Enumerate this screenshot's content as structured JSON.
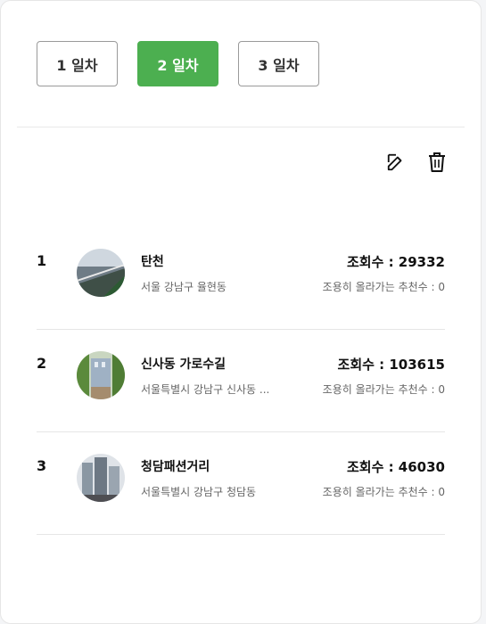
{
  "tabs": [
    {
      "label": "1 일차",
      "active": false
    },
    {
      "label": "2 일차",
      "active": true
    },
    {
      "label": "3 일차",
      "active": false
    }
  ],
  "actions": {
    "edit_icon": "edit-icon",
    "delete_icon": "trash-icon"
  },
  "places": [
    {
      "rank": "1",
      "name": "탄천",
      "address": "서울 강남구 율현동",
      "views": "조회수 : 29332",
      "recommend": "조용히 올라가는 추천수 : 0"
    },
    {
      "rank": "2",
      "name": "신사동 가로수길",
      "address": "서울특별시 강남구 신사동 ...",
      "views": "조회수 : 103615",
      "recommend": "조용히 올라가는 추천수 : 0"
    },
    {
      "rank": "3",
      "name": "청담패션거리",
      "address": "서울특별시 강남구 청담동",
      "views": "조회수 : 46030",
      "recommend": "조용히 올라가는 추천수 : 0"
    }
  ],
  "colors": {
    "accent": "#4caf50"
  }
}
